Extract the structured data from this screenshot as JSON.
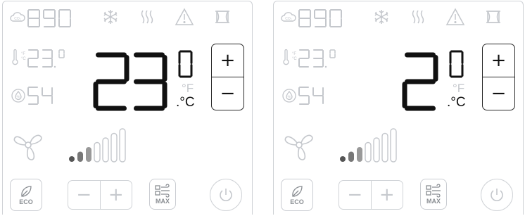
{
  "panels": [
    {
      "co2_label": "CO₂",
      "co2_value": "890",
      "temp_small_value": "23.0",
      "temp_small_unit_f": "°F",
      "temp_small_unit_c": "°C",
      "humidity_value": "54",
      "humidity_unit": "%",
      "setpoint_display": "23",
      "setpoint_decimal": "0",
      "unit_f": "°F",
      "unit_c": "°C",
      "plus_label": "+",
      "minus_label": "−",
      "eco_label": "ECO",
      "max_label": "MAX",
      "fan_speed_level": 3,
      "fan_speed_total": 7
    },
    {
      "co2_label": "CO₂",
      "co2_value": "890",
      "temp_small_value": "23.0",
      "temp_small_unit_f": "°F",
      "temp_small_unit_c": "°C",
      "humidity_value": "54",
      "humidity_unit": "%",
      "setpoint_display": "2",
      "setpoint_decimal": "0",
      "unit_f": "°F",
      "unit_c": "°C",
      "plus_label": "+",
      "minus_label": "−",
      "eco_label": "ECO",
      "max_label": "MAX",
      "fan_speed_level": 3,
      "fan_speed_total": 7
    }
  ],
  "colors": {
    "active": "#111111",
    "inactive": "#c4c7cc",
    "border": "#cfd2d6"
  },
  "icons": [
    "co2-icon",
    "snowflake-icon",
    "heat-waves-icon",
    "warning-icon",
    "window-icon",
    "thermometer-icon",
    "humidity-icon",
    "fan-icon",
    "leaf-icon",
    "max-fan-icon",
    "power-icon"
  ]
}
